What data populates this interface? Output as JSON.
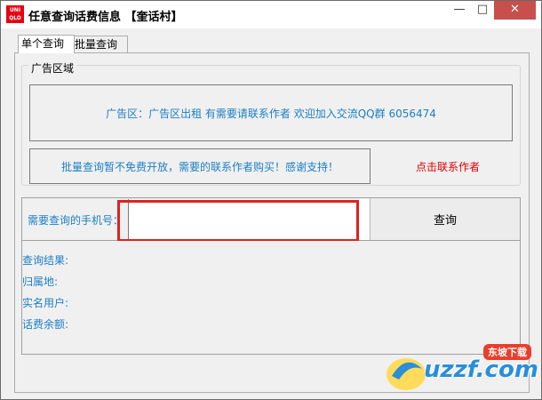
{
  "window": {
    "title": "任意查询话费信息 【奎话村】",
    "logo_text_top": "UNI",
    "logo_text_bottom": "QLO",
    "min_glyph": "—",
    "max_glyph": "□",
    "close_glyph": "✕"
  },
  "tabs": [
    {
      "label": "单个查询",
      "active": true
    },
    {
      "label": "批量查询",
      "active": false
    }
  ],
  "ad_section": {
    "legend": "广告区域",
    "ad_text": "广告区：广告区出租   有需要请联系作者  欢迎加入交流QQ群  6056474",
    "notice_text": "批量查询暂不免费开放，需要的联系作者购买！感谢支持！",
    "contact_link": "点击联系作者"
  },
  "query": {
    "phone_label": "需要查询的手机号：",
    "phone_value": "",
    "button_label": "查询"
  },
  "results": {
    "query_result_label": "查询结果:",
    "location_label": "归属地:",
    "real_name_label": "实名用户:",
    "balance_label": "话费余额:"
  },
  "watermark": {
    "badge": "东坡下载",
    "text": "uzzf.com"
  },
  "colors": {
    "accent_blue": "#1c7fc4",
    "link_red": "#e00000",
    "highlight_red": "#e02020"
  }
}
